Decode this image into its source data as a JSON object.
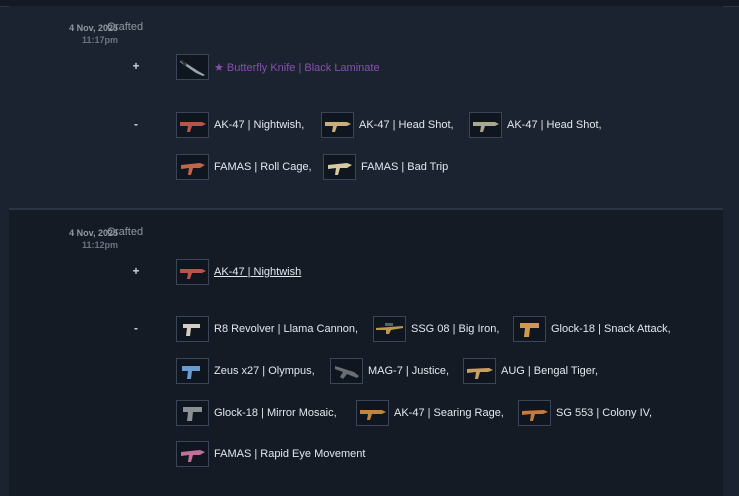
{
  "entries": [
    {
      "date": "4 Nov, 2025",
      "time": "11:17pm",
      "action": "Crafted",
      "plus_sign": "+",
      "minus_sign": "-",
      "gained": [
        {
          "label": "★ Butterfly Knife | Black Laminate",
          "color": "#8650ac",
          "icon": "knife-icon"
        }
      ],
      "lost": [
        {
          "label": "AK-47 | Nightwish,",
          "icon": "rifle-icon"
        },
        {
          "label": "AK-47 | Head Shot,",
          "icon": "rifle-icon"
        },
        {
          "label": "AK-47 | Head Shot,",
          "icon": "rifle-icon"
        },
        {
          "label": "FAMAS | Roll Cage,",
          "icon": "rifle-icon"
        },
        {
          "label": "FAMAS | Bad Trip",
          "icon": "rifle-icon"
        }
      ]
    },
    {
      "date": "4 Nov, 2025",
      "time": "11:12pm",
      "action": "Crafted",
      "plus_sign": "+",
      "minus_sign": "-",
      "gained": [
        {
          "label": "AK-47 | Nightwish",
          "icon": "rifle-icon"
        }
      ],
      "lost": [
        {
          "label": "R8 Revolver | Llama Cannon,",
          "icon": "pistol-icon"
        },
        {
          "label": "SSG 08 | Big Iron,",
          "icon": "sniper-icon"
        },
        {
          "label": "Glock-18 | Snack Attack,",
          "icon": "pistol-icon"
        },
        {
          "label": "Zeus x27 | Olympus,",
          "icon": "pistol-icon"
        },
        {
          "label": "MAG-7 | Justice,",
          "icon": "shotgun-icon"
        },
        {
          "label": "AUG | Bengal Tiger,",
          "icon": "rifle-icon"
        },
        {
          "label": "Glock-18 | Mirror Mosaic,",
          "icon": "pistol-icon"
        },
        {
          "label": "AK-47 | Searing Rage,",
          "icon": "rifle-icon"
        },
        {
          "label": "SG 553 | Colony IV,",
          "icon": "rifle-icon"
        },
        {
          "label": "FAMAS | Rapid Eye Movement",
          "icon": "rifle-icon"
        }
      ]
    }
  ]
}
